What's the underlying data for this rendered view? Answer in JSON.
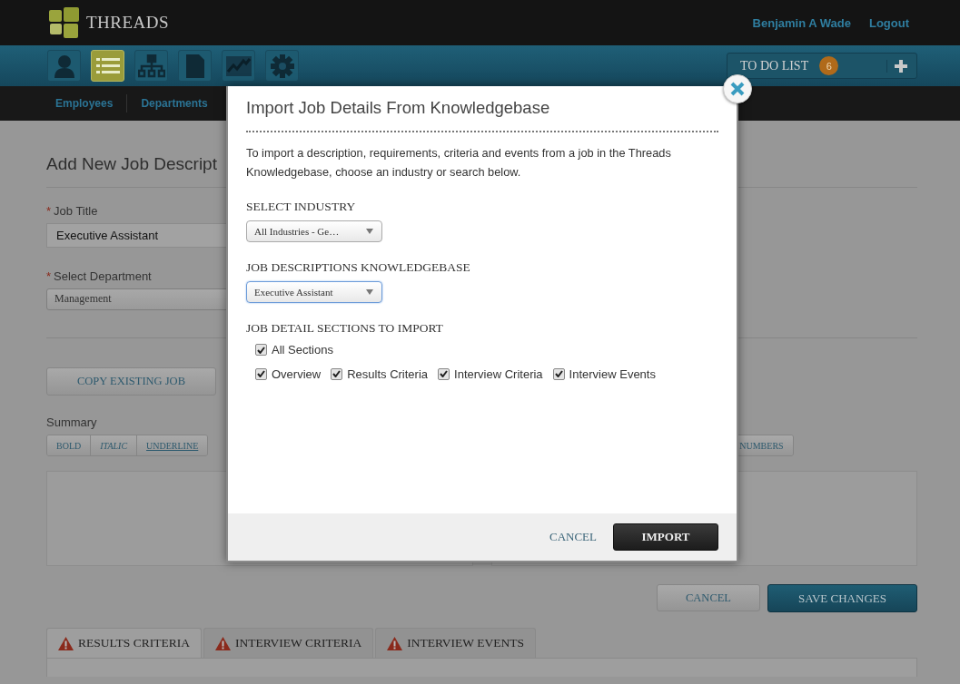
{
  "header": {
    "logo_text": "THREADS",
    "user_name": "Benjamin A Wade",
    "logout": "Logout"
  },
  "toolbar": {
    "icons": [
      {
        "kind": "person",
        "selected": false
      },
      {
        "kind": "list",
        "selected": true
      },
      {
        "kind": "org",
        "selected": false
      },
      {
        "kind": "document",
        "selected": false
      },
      {
        "kind": "chart",
        "selected": false
      },
      {
        "kind": "gear",
        "selected": false
      }
    ],
    "todo": {
      "label": "TO DO LIST",
      "count": "6"
    }
  },
  "subnav": [
    {
      "label": "Employees"
    },
    {
      "label": "Departments"
    }
  ],
  "page": {
    "title": "Add New Job Descript",
    "job_title": {
      "required_mark": "*",
      "label": "Job Title",
      "value": "Executive Assistant"
    },
    "department": {
      "required_mark": "*",
      "label": "Select Department",
      "value": "Management"
    },
    "copy_button": "COPY EXISTING JOB",
    "summary": {
      "label": "Summary",
      "format_buttons": [
        {
          "kind": "bold",
          "label": "BOLD"
        },
        {
          "kind": "italic",
          "label": "ITALIC"
        },
        {
          "kind": "underline",
          "label": "UNDERLINE"
        }
      ],
      "right_buttons": [
        {
          "label": "NUMBERS"
        }
      ]
    },
    "cancel": "CANCEL",
    "save": "SAVE CHANGES",
    "tabs": [
      {
        "label": "RESULTS CRITERIA",
        "warning": true,
        "selected": true
      },
      {
        "label": "INTERVIEW CRITERIA",
        "warning": true,
        "selected": false
      },
      {
        "label": "INTERVIEW EVENTS",
        "warning": true,
        "selected": false
      }
    ]
  },
  "modal": {
    "title": "Import Job Details From Knowledgebase",
    "intro": "To import a description, requirements, criteria and events from a job in the Threads Knowledgebase, choose an industry or search below.",
    "selects": [
      {
        "label": "SELECT INDUSTRY",
        "value": "All Industries - Ge…",
        "focused": false
      },
      {
        "label": "JOB DESCRIPTIONS KNOWLEDGEBASE",
        "value": "Executive Assistant",
        "focused": true
      }
    ],
    "sections": {
      "label": "JOB DETAIL SECTIONS TO IMPORT",
      "all": {
        "label": "All Sections",
        "checked": true
      },
      "items": [
        {
          "label": "Overview",
          "checked": true
        },
        {
          "label": "Results Criteria",
          "checked": true
        },
        {
          "label": "Interview Criteria",
          "checked": true
        },
        {
          "label": "Interview Events",
          "checked": true
        }
      ]
    },
    "cancel": "CANCEL",
    "import": "IMPORT"
  }
}
